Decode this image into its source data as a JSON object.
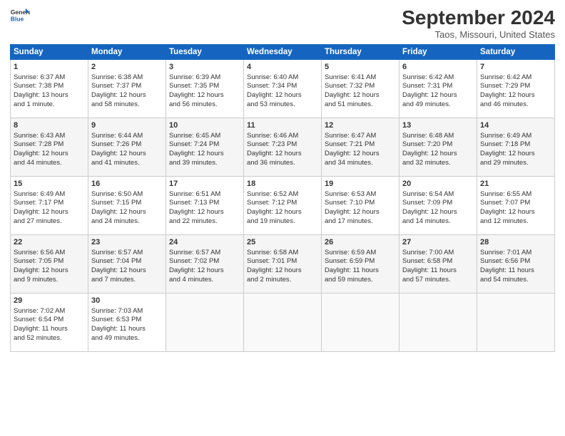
{
  "logo": {
    "line1": "General",
    "line2": "Blue"
  },
  "title": "September 2024",
  "subtitle": "Taos, Missouri, United States",
  "days_header": [
    "Sunday",
    "Monday",
    "Tuesday",
    "Wednesday",
    "Thursday",
    "Friday",
    "Saturday"
  ],
  "weeks": [
    [
      {
        "day": "1",
        "sunrise": "6:37 AM",
        "sunset": "7:38 PM",
        "daylight": "13 hours and 1 minute."
      },
      {
        "day": "2",
        "sunrise": "6:38 AM",
        "sunset": "7:37 PM",
        "daylight": "12 hours and 58 minutes."
      },
      {
        "day": "3",
        "sunrise": "6:39 AM",
        "sunset": "7:35 PM",
        "daylight": "12 hours and 56 minutes."
      },
      {
        "day": "4",
        "sunrise": "6:40 AM",
        "sunset": "7:34 PM",
        "daylight": "12 hours and 53 minutes."
      },
      {
        "day": "5",
        "sunrise": "6:41 AM",
        "sunset": "7:32 PM",
        "daylight": "12 hours and 51 minutes."
      },
      {
        "day": "6",
        "sunrise": "6:42 AM",
        "sunset": "7:31 PM",
        "daylight": "12 hours and 49 minutes."
      },
      {
        "day": "7",
        "sunrise": "6:42 AM",
        "sunset": "7:29 PM",
        "daylight": "12 hours and 46 minutes."
      }
    ],
    [
      {
        "day": "8",
        "sunrise": "6:43 AM",
        "sunset": "7:28 PM",
        "daylight": "12 hours and 44 minutes."
      },
      {
        "day": "9",
        "sunrise": "6:44 AM",
        "sunset": "7:26 PM",
        "daylight": "12 hours and 41 minutes."
      },
      {
        "day": "10",
        "sunrise": "6:45 AM",
        "sunset": "7:24 PM",
        "daylight": "12 hours and 39 minutes."
      },
      {
        "day": "11",
        "sunrise": "6:46 AM",
        "sunset": "7:23 PM",
        "daylight": "12 hours and 36 minutes."
      },
      {
        "day": "12",
        "sunrise": "6:47 AM",
        "sunset": "7:21 PM",
        "daylight": "12 hours and 34 minutes."
      },
      {
        "day": "13",
        "sunrise": "6:48 AM",
        "sunset": "7:20 PM",
        "daylight": "12 hours and 32 minutes."
      },
      {
        "day": "14",
        "sunrise": "6:49 AM",
        "sunset": "7:18 PM",
        "daylight": "12 hours and 29 minutes."
      }
    ],
    [
      {
        "day": "15",
        "sunrise": "6:49 AM",
        "sunset": "7:17 PM",
        "daylight": "12 hours and 27 minutes."
      },
      {
        "day": "16",
        "sunrise": "6:50 AM",
        "sunset": "7:15 PM",
        "daylight": "12 hours and 24 minutes."
      },
      {
        "day": "17",
        "sunrise": "6:51 AM",
        "sunset": "7:13 PM",
        "daylight": "12 hours and 22 minutes."
      },
      {
        "day": "18",
        "sunrise": "6:52 AM",
        "sunset": "7:12 PM",
        "daylight": "12 hours and 19 minutes."
      },
      {
        "day": "19",
        "sunrise": "6:53 AM",
        "sunset": "7:10 PM",
        "daylight": "12 hours and 17 minutes."
      },
      {
        "day": "20",
        "sunrise": "6:54 AM",
        "sunset": "7:09 PM",
        "daylight": "12 hours and 14 minutes."
      },
      {
        "day": "21",
        "sunrise": "6:55 AM",
        "sunset": "7:07 PM",
        "daylight": "12 hours and 12 minutes."
      }
    ],
    [
      {
        "day": "22",
        "sunrise": "6:56 AM",
        "sunset": "7:05 PM",
        "daylight": "12 hours and 9 minutes."
      },
      {
        "day": "23",
        "sunrise": "6:57 AM",
        "sunset": "7:04 PM",
        "daylight": "12 hours and 7 minutes."
      },
      {
        "day": "24",
        "sunrise": "6:57 AM",
        "sunset": "7:02 PM",
        "daylight": "12 hours and 4 minutes."
      },
      {
        "day": "25",
        "sunrise": "6:58 AM",
        "sunset": "7:01 PM",
        "daylight": "12 hours and 2 minutes."
      },
      {
        "day": "26",
        "sunrise": "6:59 AM",
        "sunset": "6:59 PM",
        "daylight": "11 hours and 59 minutes."
      },
      {
        "day": "27",
        "sunrise": "7:00 AM",
        "sunset": "6:58 PM",
        "daylight": "11 hours and 57 minutes."
      },
      {
        "day": "28",
        "sunrise": "7:01 AM",
        "sunset": "6:56 PM",
        "daylight": "11 hours and 54 minutes."
      }
    ],
    [
      {
        "day": "29",
        "sunrise": "7:02 AM",
        "sunset": "6:54 PM",
        "daylight": "11 hours and 52 minutes."
      },
      {
        "day": "30",
        "sunrise": "7:03 AM",
        "sunset": "6:53 PM",
        "daylight": "11 hours and 49 minutes."
      },
      null,
      null,
      null,
      null,
      null
    ]
  ]
}
